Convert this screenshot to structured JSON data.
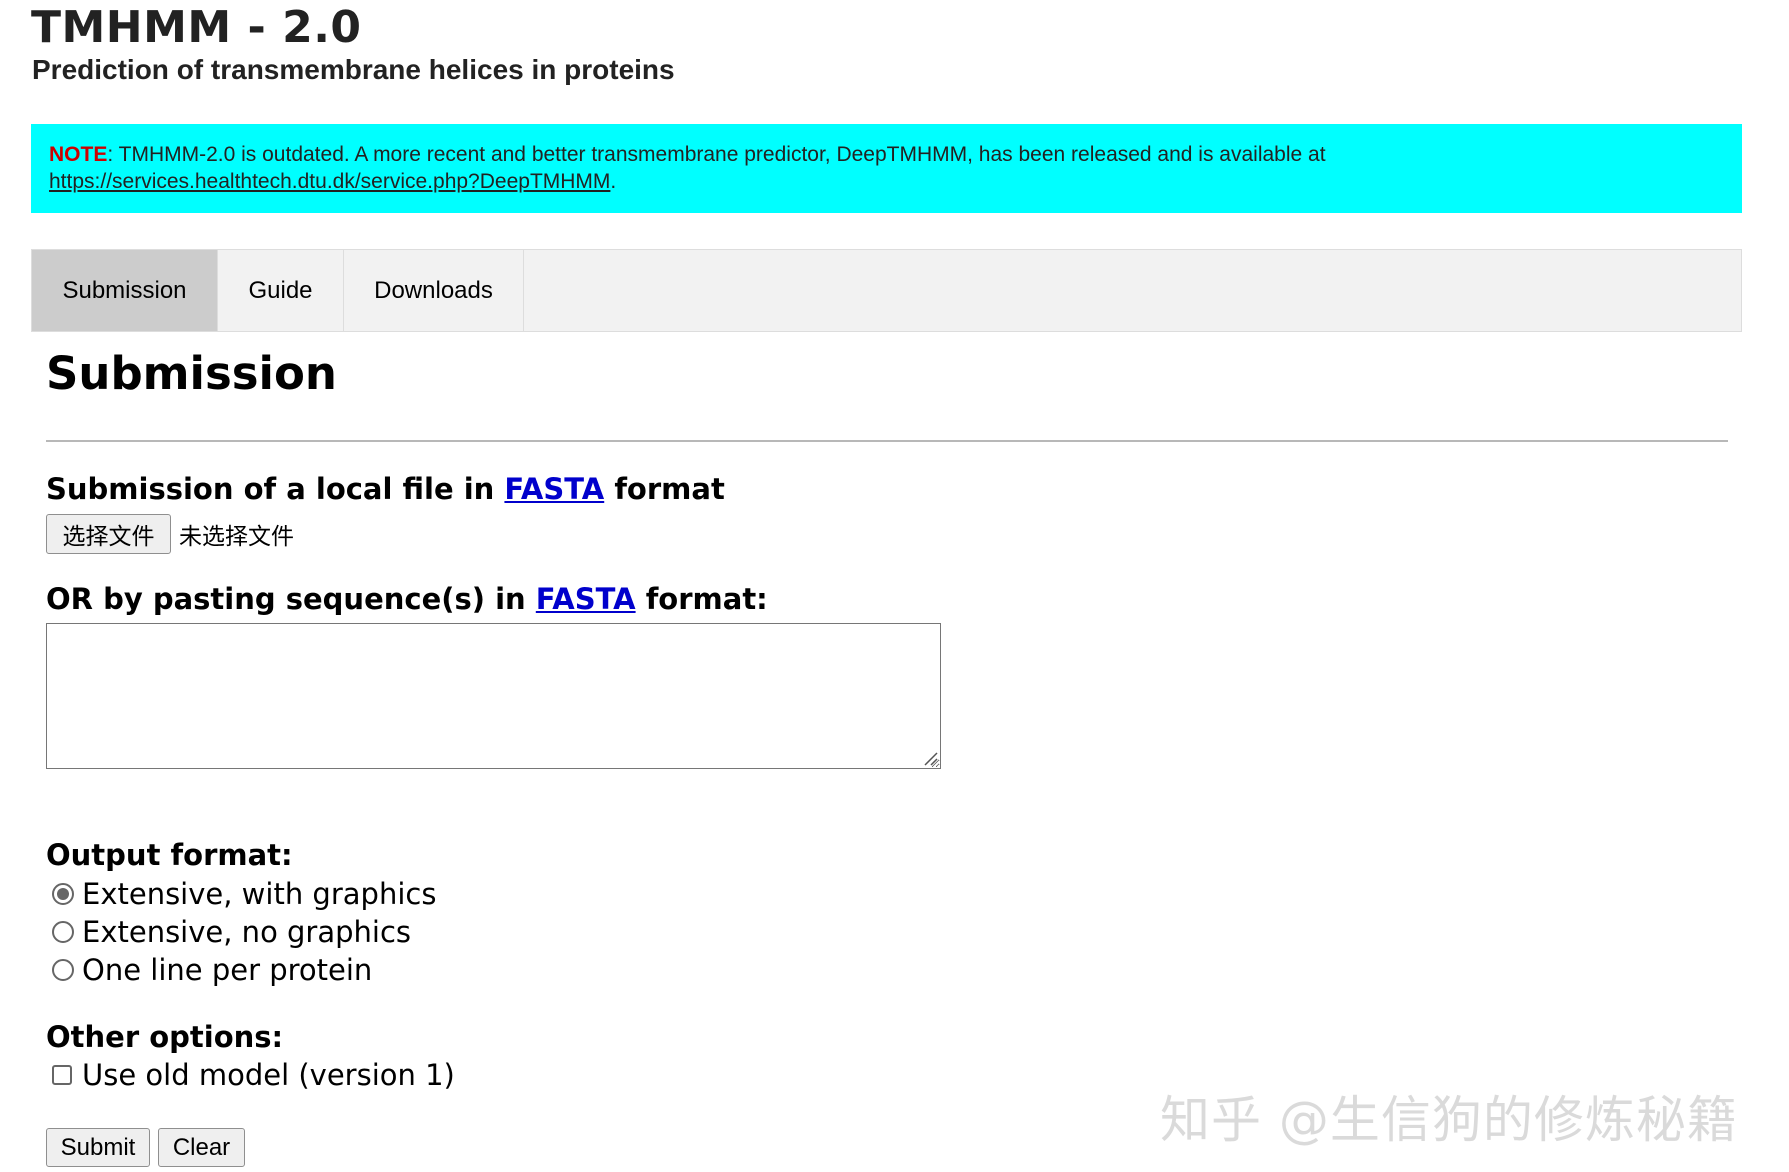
{
  "header": {
    "title": "TMHMM - 2.0",
    "subtitle": "Prediction of transmembrane helices in proteins"
  },
  "notice": {
    "label": "NOTE",
    "text": ": TMHMM-2.0 is outdated. A more recent and better transmembrane predictor, DeepTMHMM, has been released and is available at",
    "link": "https://services.healthtech.dtu.dk/service.php?DeepTMHMM",
    "suffix": ".",
    "background_color": "#00ffff",
    "label_color": "#cc0000"
  },
  "tabs": [
    {
      "label": "Submission",
      "active": true
    },
    {
      "label": "Guide",
      "active": false
    },
    {
      "label": "Downloads",
      "active": false
    }
  ],
  "page_title": "Submission",
  "file_upload": {
    "heading_prefix": "Submission of a local file in ",
    "heading_link": "FASTA",
    "heading_suffix": " format",
    "button_label": "选择文件",
    "status": "未选择文件"
  },
  "paste": {
    "heading_prefix": "OR by pasting sequence(s) in ",
    "heading_link": "FASTA",
    "heading_suffix": " format:",
    "value": ""
  },
  "output_format": {
    "heading": "Output format:",
    "options": [
      {
        "label": "Extensive, with graphics",
        "checked": true
      },
      {
        "label": "Extensive, no graphics",
        "checked": false
      },
      {
        "label": "One line per protein",
        "checked": false
      }
    ]
  },
  "other_options": {
    "heading": "Other options:",
    "old_model_label": "Use old model (version 1)",
    "old_model_checked": false
  },
  "buttons": {
    "submit": "Submit",
    "clear": "Clear"
  },
  "watermark": "知乎 @生信狗的修炼秘籍",
  "colors": {
    "link": "#0000cc",
    "active_tab": "#cccccc",
    "tabbar": "#f2f2f2"
  }
}
